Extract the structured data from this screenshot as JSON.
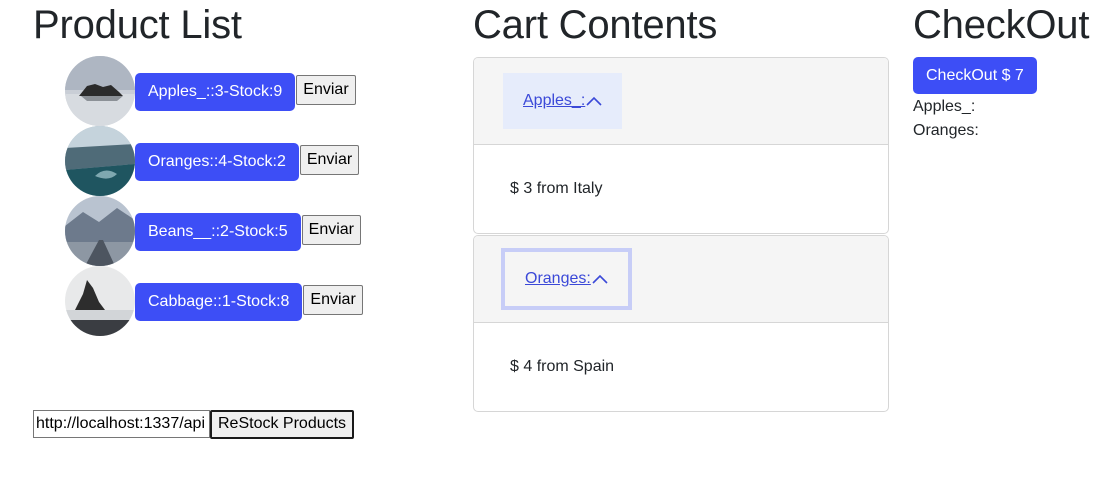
{
  "products": {
    "title": "Product List",
    "items": [
      {
        "label": "Apples_::3-Stock:9",
        "send_label": "Enviar",
        "image": "lake-rock-thumbnail"
      },
      {
        "label": "Oranges::4-Stock:2",
        "send_label": "Enviar",
        "image": "coast-thumbnail"
      },
      {
        "label": "Beans__::2-Stock:5",
        "send_label": "Enviar",
        "image": "mountain-road-thumbnail"
      },
      {
        "label": "Cabbage::1-Stock:8",
        "send_label": "Enviar",
        "image": "rock-beach-thumbnail"
      }
    ],
    "restock_url_value": "http://localhost:1337/api",
    "restock_button_label": "ReStock Products"
  },
  "cart": {
    "title": "Cart Contents",
    "items": [
      {
        "toggle_label": "Apples_:",
        "detail": "$ 3 from Italy",
        "chevron": "chevron-up-icon"
      },
      {
        "toggle_label": "Oranges:",
        "detail": "$ 4 from Spain",
        "chevron": "chevron-up-icon"
      }
    ]
  },
  "checkout": {
    "title": "CheckOut",
    "button_label": "CheckOut $ 7",
    "items": [
      "Apples_:",
      "Oranges:"
    ]
  },
  "colors": {
    "primary_button": "#3d4ef6",
    "link": "#3b49d8",
    "accordion_header_bg": "#f5f5f5",
    "active_toggle_bg": "#e6ecfb"
  }
}
